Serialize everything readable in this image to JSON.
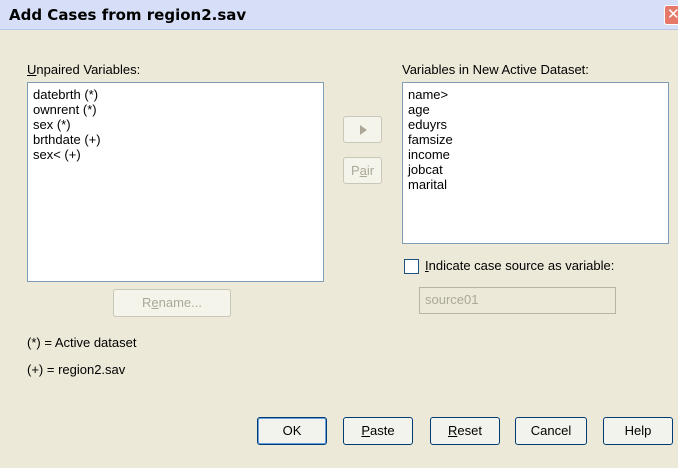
{
  "window": {
    "title": "Add Cases from region2.sav"
  },
  "unpaired": {
    "label_mnemonic": "U",
    "label_rest": "npaired Variables:",
    "items": [
      "datebrth (*)",
      "ownrent (*)",
      "sex (*)",
      "brthdate (+)",
      "sex< (+)"
    ]
  },
  "active_dataset": {
    "label": "Variables in New Active Dataset:",
    "items": [
      "name>",
      "age",
      "eduyrs",
      "famsize",
      "income",
      "jobcat",
      "marital"
    ]
  },
  "buttons": {
    "pair_pre": "P",
    "pair_mnemonic": "a",
    "pair_post": "ir",
    "rename_pre": "R",
    "rename_mnemonic": "e",
    "rename_post": "name...",
    "ok": "OK",
    "paste_mnemonic": "P",
    "paste_rest": "aste",
    "reset_mnemonic": "R",
    "reset_rest": "eset",
    "cancel": "Cancel",
    "help": "Help"
  },
  "case_source": {
    "checked": false,
    "label_mnemonic": "I",
    "label_rest": "ndicate case source as variable:",
    "value": "source01"
  },
  "legend": {
    "active": "(*) = Active dataset",
    "other": "(+) = region2.sav"
  },
  "colors": {
    "titlebar": "#d6dff7",
    "dialog": "#ece9d8",
    "close": "#e6786a"
  }
}
